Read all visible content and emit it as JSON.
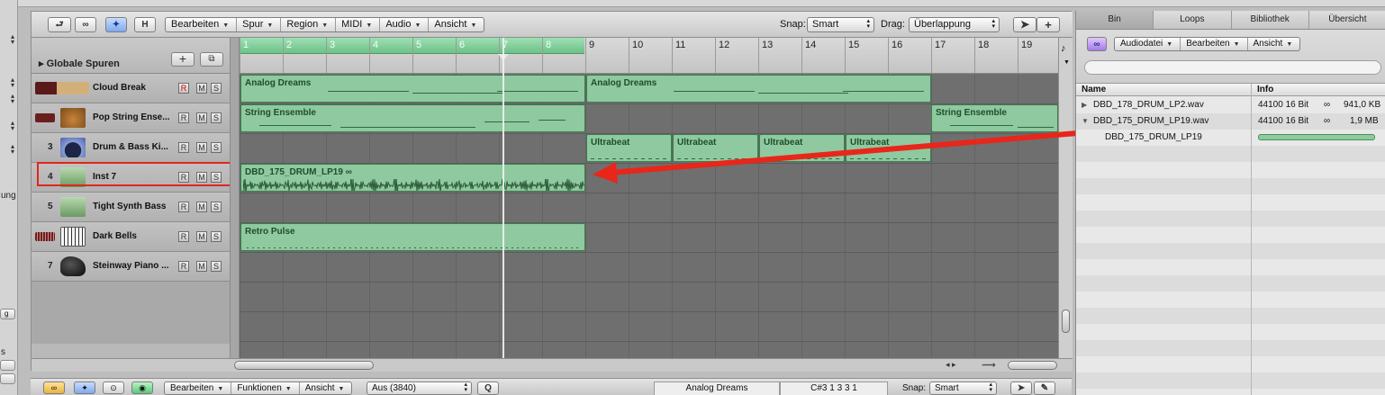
{
  "toolbar": {
    "h_button": "H",
    "menus": [
      "Bearbeiten",
      "Spur",
      "Region",
      "MIDI",
      "Audio",
      "Ansicht"
    ],
    "snap_label": "Snap:",
    "snap_value": "Smart",
    "drag_label": "Drag:",
    "drag_value": "Überlappung"
  },
  "global_tracks_label": "Globale Spuren",
  "ruler": {
    "bars": [
      "1",
      "2",
      "3",
      "4",
      "5",
      "6",
      "7",
      "8",
      "9",
      "10",
      "11",
      "12",
      "13",
      "14",
      "15",
      "16",
      "17",
      "18",
      "19"
    ]
  },
  "tracks": [
    {
      "num": "",
      "name": "Cloud Break",
      "icon": "es2-synth-icon"
    },
    {
      "num": "",
      "name": "Pop String Ense...",
      "icon": "violin-icon"
    },
    {
      "num": "3",
      "name": "Drum & Bass Ki...",
      "icon": "drum-icon"
    },
    {
      "num": "4",
      "name": "Inst 7",
      "icon": "audio-wave-icon"
    },
    {
      "num": "5",
      "name": "Tight Synth Bass",
      "icon": "audio-wave-icon"
    },
    {
      "num": "",
      "name": "Dark Bells",
      "icon": "keyboard-icon"
    },
    {
      "num": "7",
      "name": "Steinway Piano ...",
      "icon": "grand-piano-icon"
    }
  ],
  "rms": {
    "r": "R",
    "m": "M",
    "s": "S"
  },
  "regions": {
    "analog1": "Analog Dreams",
    "analog2": "Analog Dreams",
    "string1": "String Ensemble",
    "string2": "String Ensemble",
    "ultra1": "Ultrabeat",
    "ultra2": "Ultrabeat",
    "ultra3": "Ultrabeat",
    "ultra4": "Ultrabeat",
    "audio": "DBD_175_DRUM_LP19",
    "retro": "Retro Pulse"
  },
  "right_panel": {
    "tabs": [
      "Bin",
      "Loops",
      "Bibliothek",
      "Übersicht"
    ],
    "menus": [
      "Audiodatei",
      "Bearbeiten",
      "Ansicht"
    ],
    "col_name": "Name",
    "col_info": "Info",
    "files": [
      {
        "name": "DBD_178_DRUM_LP2.wav",
        "info": "44100 16 Bit",
        "size": "941,0 KB"
      },
      {
        "name": "DBD_175_DRUM_LP19.wav",
        "info": "44100 16 Bit",
        "size": "1,9 MB"
      }
    ],
    "child": "DBD_175_DRUM_LP19",
    "child_progress": 1.0
  },
  "bottom_bar": {
    "menus": [
      "Bearbeiten",
      "Funktionen",
      "Ansicht"
    ],
    "region_select": "Aus (3840)",
    "q_button": "Q",
    "region_name": "Analog Dreams",
    "position": "C#3  1 3 3 1",
    "snap_label": "Snap:",
    "snap_value": "Smart"
  },
  "left_strip": {
    "t1": "ung",
    "t2": "g",
    "t3": "s"
  },
  "colors": {
    "region_green": "#8fc99f",
    "highlight_red": "#e1261c",
    "arrow_red": "#e8261a"
  }
}
